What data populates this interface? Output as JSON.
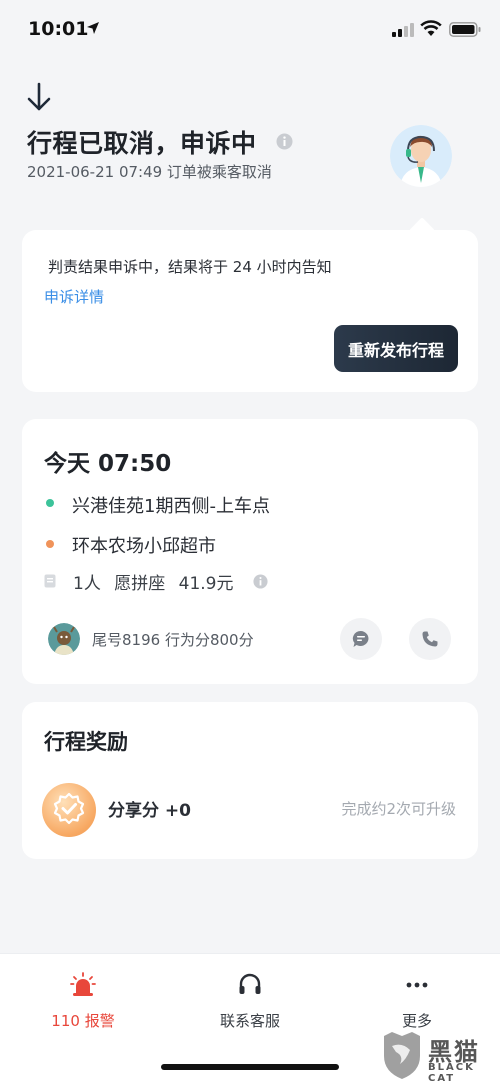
{
  "status_bar": {
    "time": "10:01"
  },
  "header": {
    "title": "行程已取消，申诉中",
    "subtitle": "2021-06-21 07:49 订单被乘客取消"
  },
  "appeal_card": {
    "message": "判责结果申诉中，结果将于 24 小时内告知",
    "link": "申诉详情",
    "button": "重新发布行程"
  },
  "trip_card": {
    "time": "今天 07:50",
    "from": "兴港佳苑1期西侧-上车点",
    "to": "环本农场小邱超市",
    "seat_info": "1人 愿拼座 41.9元",
    "driver_info": "尾号8196 行为分800分"
  },
  "reward_card": {
    "title": "行程奖励",
    "label": "分享分 +0",
    "note": "完成约2次可升级"
  },
  "bottom_bar": {
    "alarm": "110 报警",
    "service": "联系客服",
    "more": "更多"
  },
  "watermark": {
    "cn": "黑猫",
    "en": "BLACK CAT"
  },
  "colors": {
    "link": "#3a8ee6",
    "alarm": "#e8473b",
    "start_dot": "#3cc39a",
    "end_dot": "#f0935a",
    "primary_button": "#1d2734"
  },
  "icons": [
    "location-arrow-icon",
    "signal-icon",
    "wifi-icon",
    "battery-icon",
    "down-arrow-icon",
    "info-icon",
    "ticket-icon",
    "chat-icon",
    "phone-icon",
    "badge-check-icon",
    "alarm-light-icon",
    "headset-icon",
    "more-dots-icon"
  ]
}
